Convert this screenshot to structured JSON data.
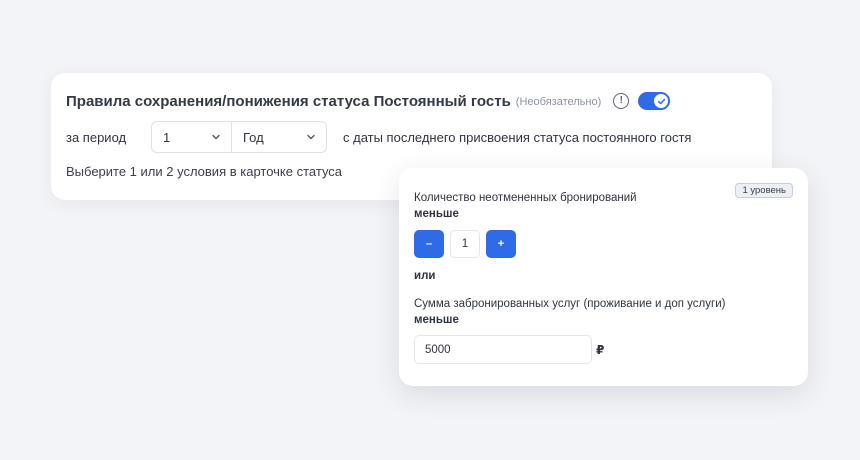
{
  "main_card": {
    "title": "Правила сохранения/понижения статуса Постоянный гость",
    "optional_label": "(Необязательно)",
    "info_icon_glyph": "!",
    "toggle_on": true,
    "period_label": "за период",
    "period_value": "1",
    "period_unit": "Год",
    "period_tail": "с даты последнего присвоения статуса постоянного гостя",
    "hint": "Выберите 1 или 2 условия в карточке статуса"
  },
  "level_card": {
    "badge": "1 уровень",
    "condition1_label": "Количество неотмененных бронирований",
    "condition1_comparator": "меньше",
    "stepper_minus": "–",
    "stepper_value": "1",
    "stepper_plus": "+",
    "or_label": "или",
    "condition2_label": "Сумма забронированных услуг (проживание и доп услуги)",
    "condition2_comparator": "меньше",
    "sum_value": "5000",
    "currency": "₽"
  },
  "colors": {
    "accent": "#2f6be6",
    "background": "#f3f4f7"
  },
  "icons": [
    "info-icon",
    "toggle-check-icon",
    "chevron-down-icon"
  ]
}
